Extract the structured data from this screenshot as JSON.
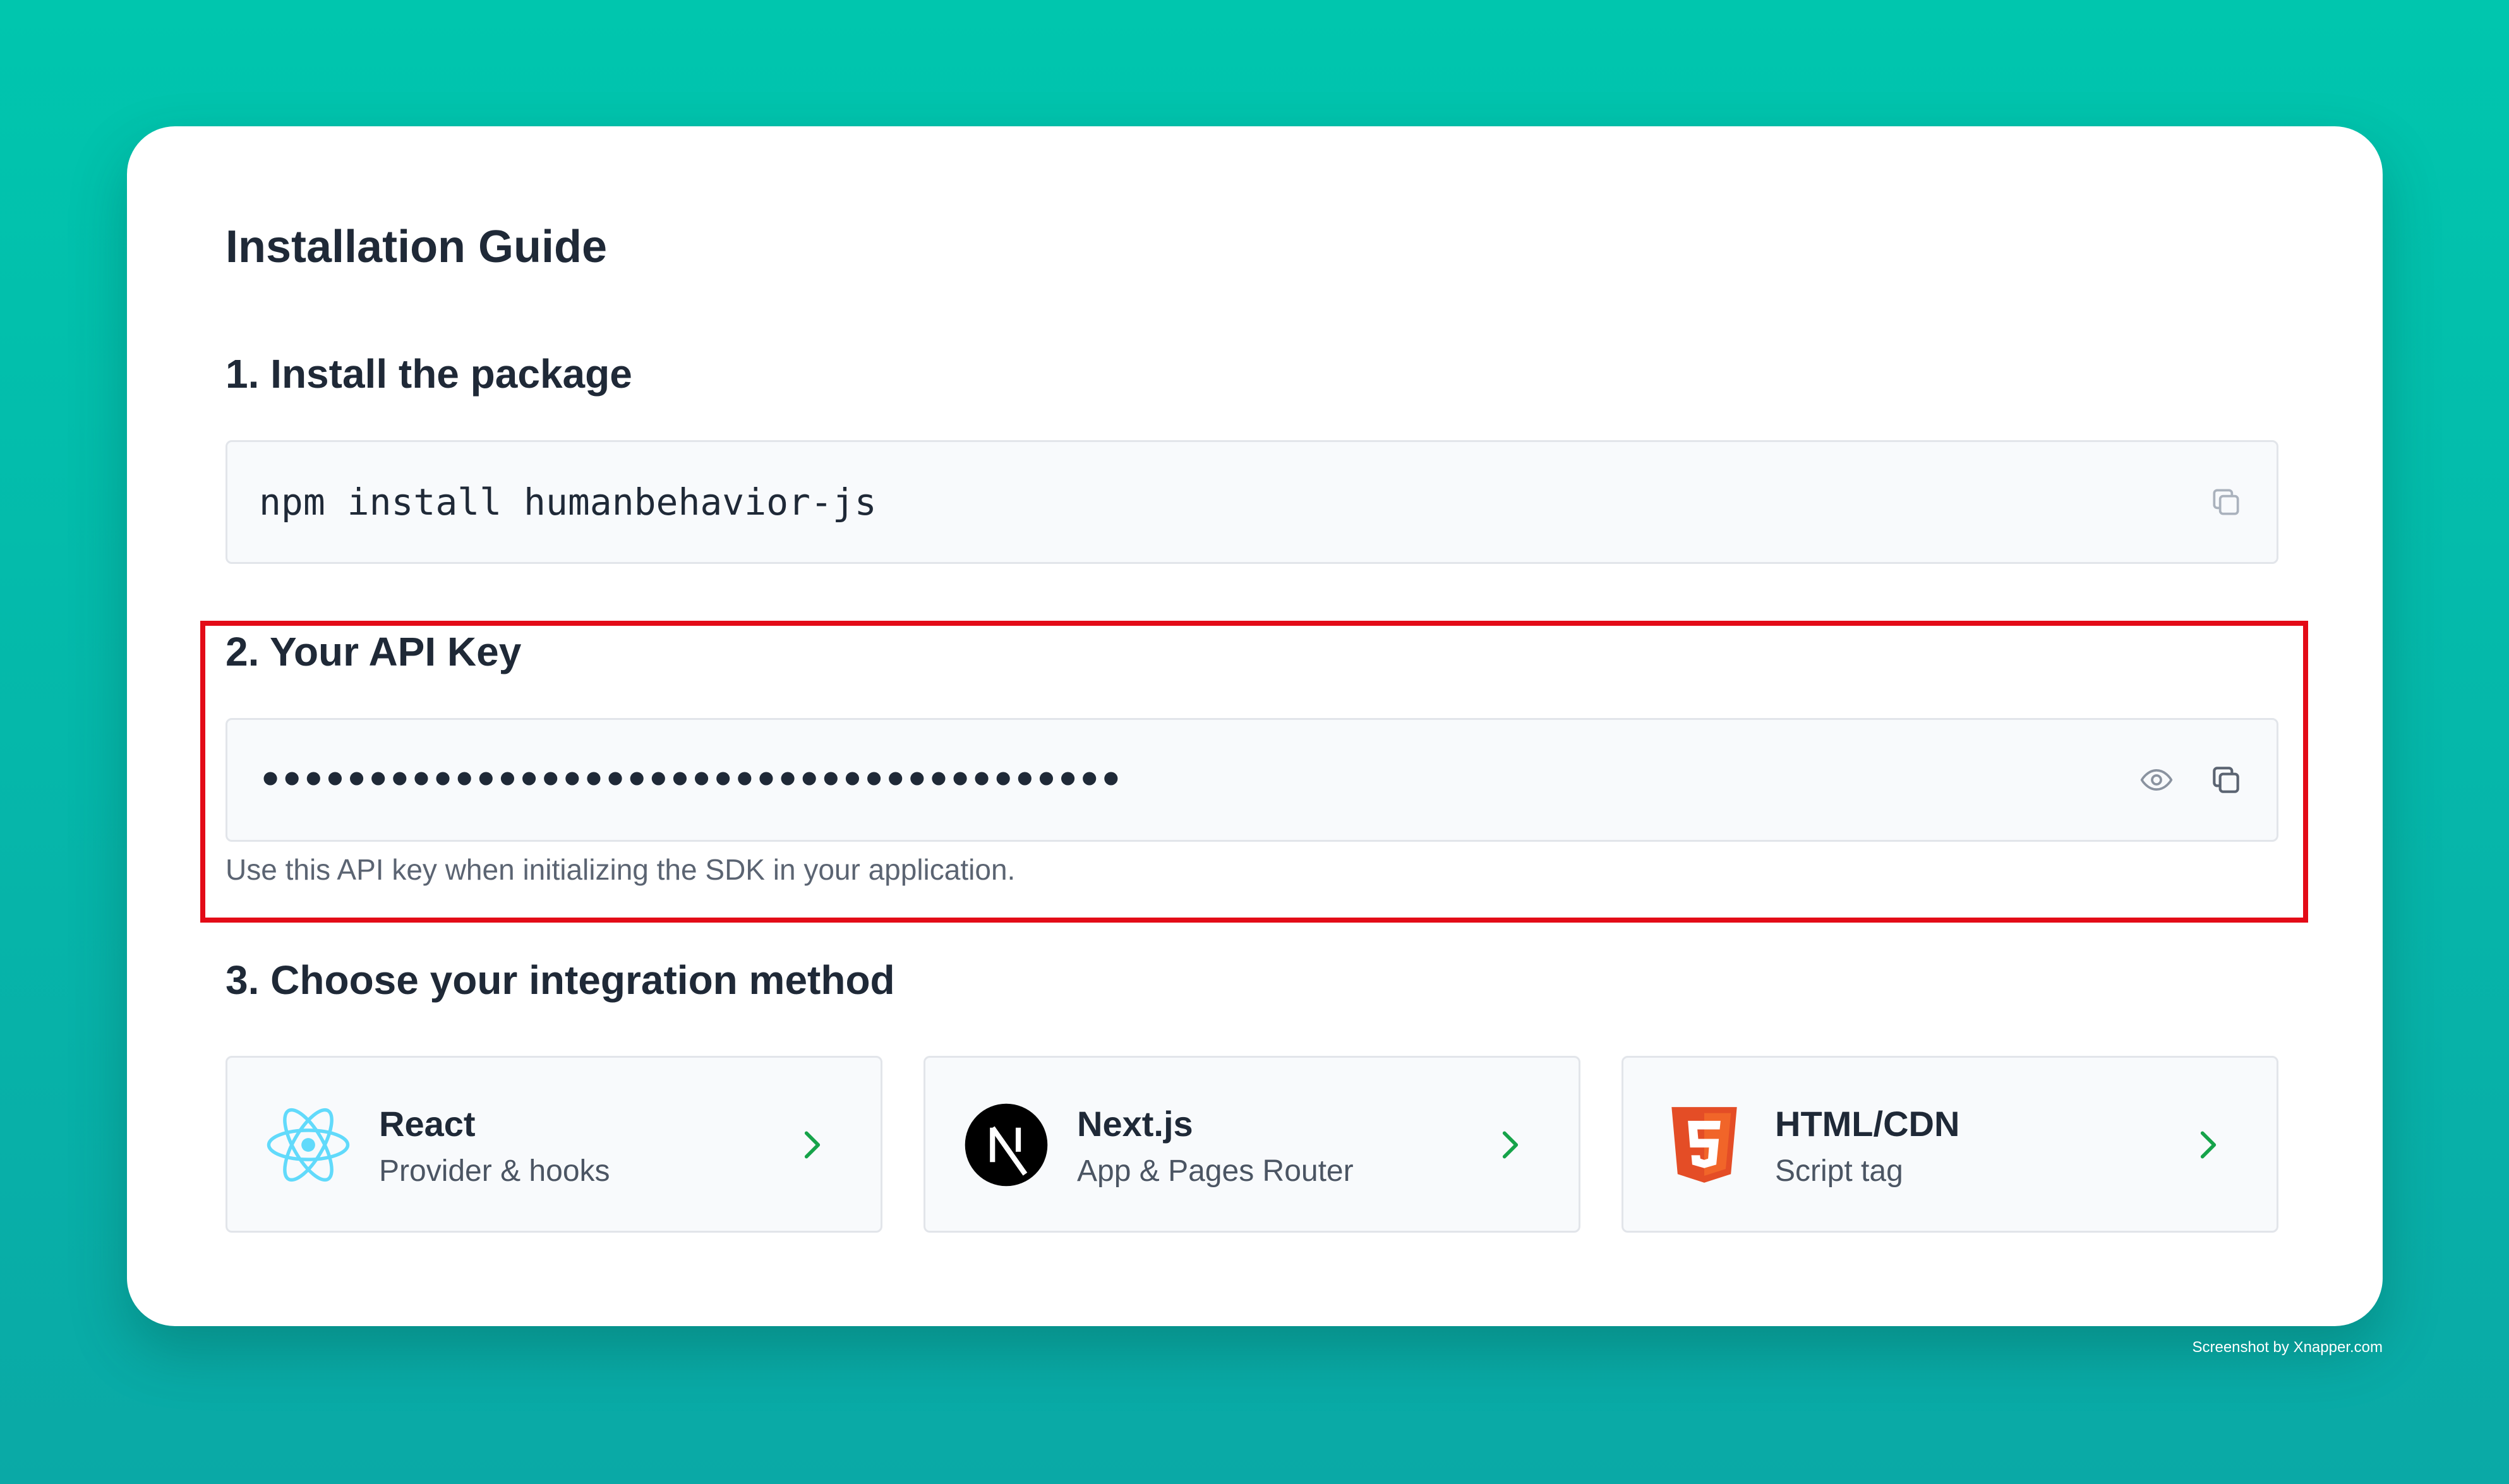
{
  "guide": {
    "title": "Installation Guide"
  },
  "step1": {
    "heading": "1. Install the package",
    "command": "npm install humanbehavior-js",
    "copy_icon": "copy-icon"
  },
  "step2": {
    "heading": "2. Your API Key",
    "masked_key": "••••••••••••••••••••••••••••••••••••••••",
    "hint": "Use this API key when initializing the SDK in your application.",
    "reveal_icon": "eye-icon",
    "copy_icon": "copy-icon"
  },
  "step3": {
    "heading": "3. Choose your integration method",
    "methods": [
      {
        "name": "React",
        "subtitle": "Provider & hooks",
        "icon": "react-logo-icon"
      },
      {
        "name": "Next.js",
        "subtitle": "App & Pages Router",
        "icon": "nextjs-logo-icon"
      },
      {
        "name": "HTML/CDN",
        "subtitle": "Script tag",
        "icon": "html5-logo-icon"
      }
    ]
  },
  "colors": {
    "background": "#00c6ae",
    "highlight": "#e30b17",
    "chevron": "#16a34a",
    "react": "#61dafb",
    "html5": "#e44d26"
  },
  "watermark": "Screenshot by Xnapper.com"
}
